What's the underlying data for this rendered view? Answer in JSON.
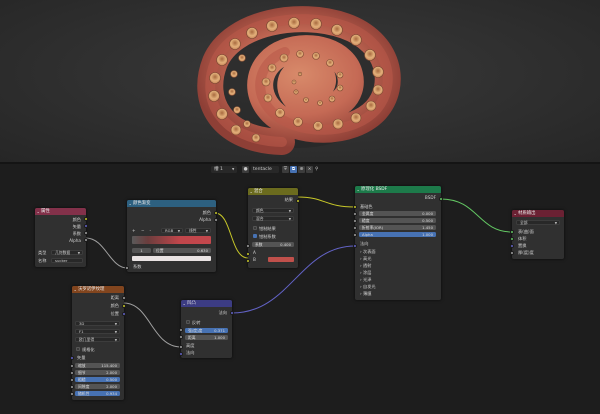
{
  "header": {
    "slot_label": "槽 1",
    "material_name": "tentacle"
  },
  "nodes": {
    "attribute": {
      "title": "属性",
      "outputs": [
        "颜色",
        "矢量",
        "系数",
        "Alpha"
      ],
      "type_label": "类型",
      "type_value": "几何数据",
      "name_label": "名称",
      "name_value": "sucker"
    },
    "colorramp": {
      "title": "颜色渐变",
      "outputs": [
        "颜色",
        "Alpha"
      ],
      "mode": "RGB",
      "interp": "线性",
      "stop_index": "1",
      "pos_label": "位置",
      "pos_value": "0.630",
      "input": "系数"
    },
    "mix": {
      "title": "混合",
      "output": "结果",
      "type": "颜色",
      "blend": "混合",
      "clamp_result": "钳制结果",
      "clamp_factor": "钳制系数",
      "factor_label": "系数",
      "factor_value": "0.400",
      "input_a": "A",
      "input_b": "B"
    },
    "bsdf": {
      "title": "原理化 BSDF",
      "output": "BSDF",
      "base_color": "基础色",
      "metallic_label": "金属度",
      "metallic_value": "0.000",
      "roughness_label": "糙度",
      "roughness_value": "0.500",
      "ior_label": "折射率(IOR)",
      "ior_value": "1.450",
      "alpha_label": "Alpha",
      "alpha_value": "1.000",
      "normal": "法向",
      "panels": [
        "次表面",
        "高光",
        "透射",
        "涂层",
        "光泽",
        "自发光",
        "薄膜"
      ]
    },
    "output": {
      "title": "材质输出",
      "target": "全部",
      "inputs": [
        "表(曲)面",
        "体积",
        "置换",
        "厚(度)度"
      ]
    },
    "bump": {
      "title": "凹凸",
      "output": "法向",
      "invert": "反转",
      "strength_label": "强(度)度",
      "strength_value": "0.371",
      "distance_label": "距离",
      "distance_value": "1.000",
      "height": "高度",
      "normal": "法向"
    },
    "noise": {
      "title": "沃罗诺伊纹理",
      "outputs": [
        "距离",
        "颜色",
        "位置"
      ],
      "dim": "3D",
      "feature": "F1",
      "metric": "欧几里得",
      "normalize": "规格化",
      "vector": "矢量",
      "params": [
        {
          "label": "缩放",
          "value": "115.400"
        },
        {
          "label": "细节",
          "value": "2.000"
        },
        {
          "label": "粗糙",
          "value": "0.500"
        },
        {
          "label": "间隙度",
          "value": "2.000"
        },
        {
          "label": "随机性",
          "value": "0.934"
        }
      ]
    }
  },
  "colors": {
    "header_attr": "#83314a",
    "header_tex": "#2d6080",
    "header_mix": "#6b6b1e",
    "header_shader": "#1d7a4a",
    "header_output": "#6b2133",
    "header_vec": "#3c3c83",
    "header_noise": "#82451e"
  }
}
